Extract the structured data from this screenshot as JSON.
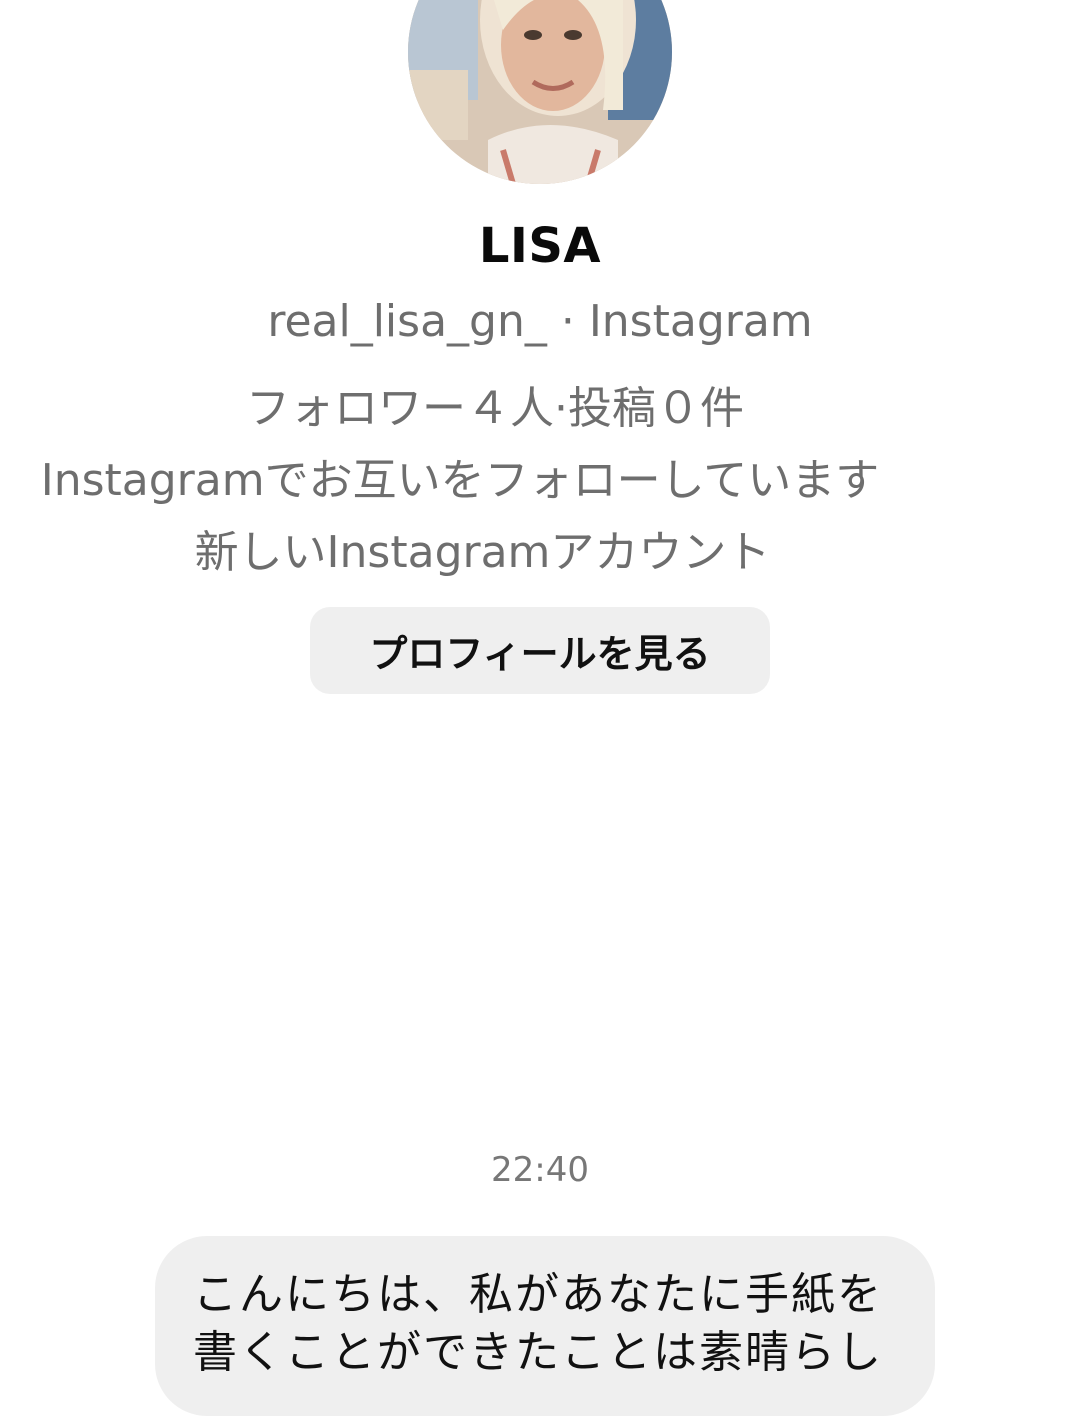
{
  "profile": {
    "name": "LISA",
    "handle_line": "real_lisa_gn_ · Instagram",
    "stats_line": "フォロワー４人·投稿０件",
    "mutual_line": "Instagramでお互いをフォローしています",
    "new_account_line": "新しいInstagramアカウント",
    "view_profile_label": "プロフィールを見る"
  },
  "thread": {
    "timestamp": "22:40",
    "messages": [
      {
        "text": "こんにちは、私があなたに手紙を書くことができたことは素晴らし"
      }
    ]
  },
  "colors": {
    "background": "#ffffff",
    "secondary_text": "#6e6e6e",
    "button_bg": "#efefef",
    "bubble_bg": "#efefef"
  }
}
